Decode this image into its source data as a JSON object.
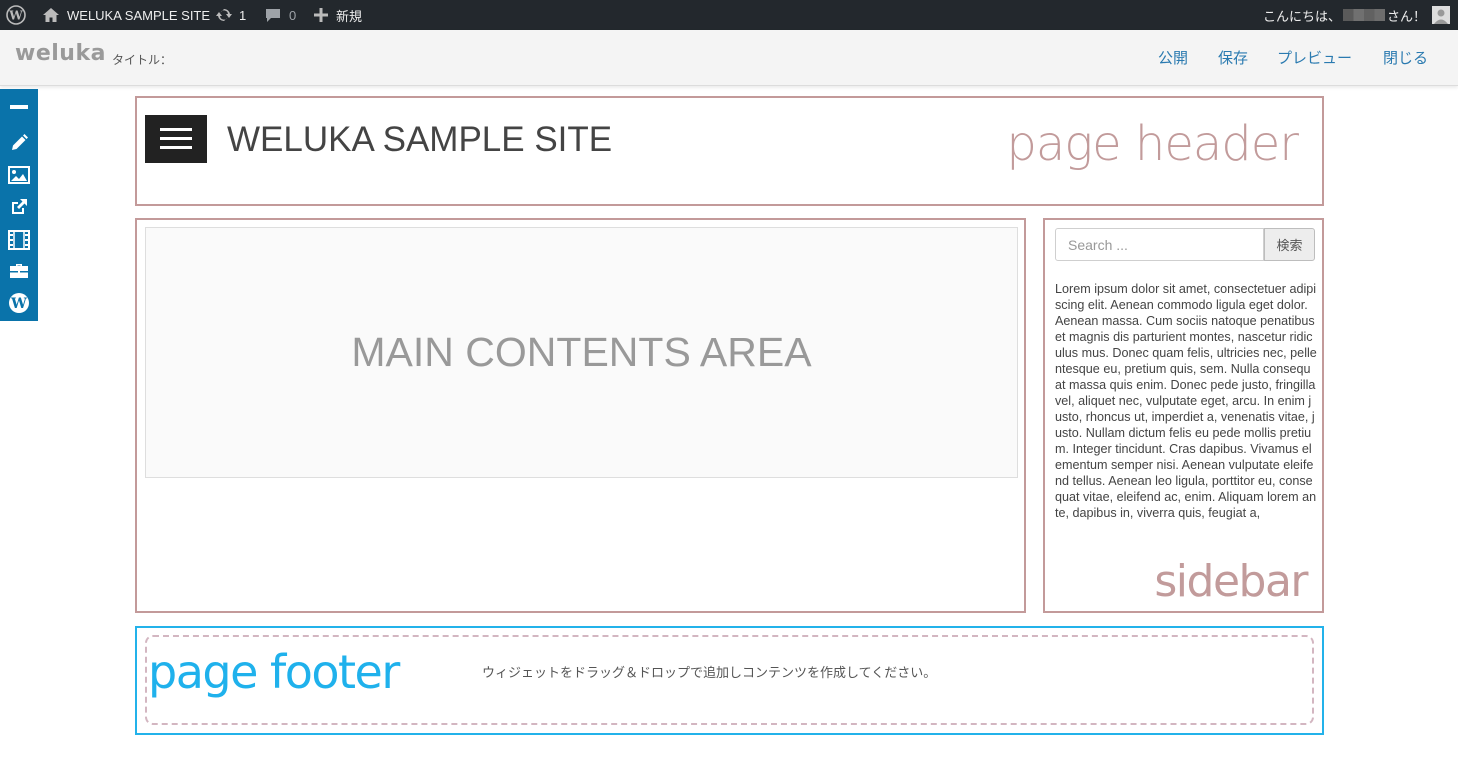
{
  "admin_bar": {
    "site_name": "WELUKA SAMPLE SITE",
    "updates_count": "1",
    "comments_count": "0",
    "new_label": "新規",
    "greeting_prefix": "こんにちは、",
    "greeting_suffix": "さん！"
  },
  "editor_bar": {
    "logo": "weluka",
    "title_label": "タイトル：",
    "actions": {
      "publish": "公開",
      "save": "保存",
      "preview": "プレビュー",
      "close": "閉じる"
    }
  },
  "left_toolbar": {
    "icons": [
      "minus-icon",
      "pencil-icon",
      "image-icon",
      "external-link-icon",
      "film-icon",
      "briefcase-icon",
      "wordpress-icon"
    ]
  },
  "header": {
    "site_title": "WELUKA SAMPLE SITE",
    "region_label": "page header"
  },
  "main": {
    "region_label": "MAIN CONTENTS AREA"
  },
  "sidebar": {
    "search_placeholder": "Search ...",
    "search_button": "検索",
    "text": "Lorem ipsum dolor sit amet, consectetuer adipiscing elit. Aenean commodo ligula eget dolor. Aenean massa. Cum sociis natoque penatibus et magnis dis parturient montes, nascetur ridiculus mus. Donec quam felis, ultricies nec, pellentesque eu, pretium quis, sem. Nulla consequat massa quis enim. Donec pede justo, fringilla vel, aliquet nec, vulputate eget, arcu. In enim justo, rhoncus ut, imperdiet a, venenatis vitae, justo. Nullam dictum felis eu pede mollis pretium. Integer tincidunt. Cras dapibus. Vivamus elementum semper nisi. Aenean vulputate eleifend tellus. Aenean leo ligula, porttitor eu, consequat vitae, eleifend ac, enim. Aliquam lorem ante, dapibus in, viverra quis, feugiat a,",
    "region_label": "sidebar"
  },
  "footer": {
    "region_label": "page footer",
    "drop_message": "ウィジェットをドラッグ＆ドロップで追加しコンテンツを作成してください。"
  },
  "colors": {
    "admin_bar_bg": "#23282d",
    "toolbar_blue": "#0a73aa",
    "region_border_rose": "#c39a9a",
    "footer_border_blue": "#23b2ea",
    "link_blue": "#2a7ab0"
  }
}
